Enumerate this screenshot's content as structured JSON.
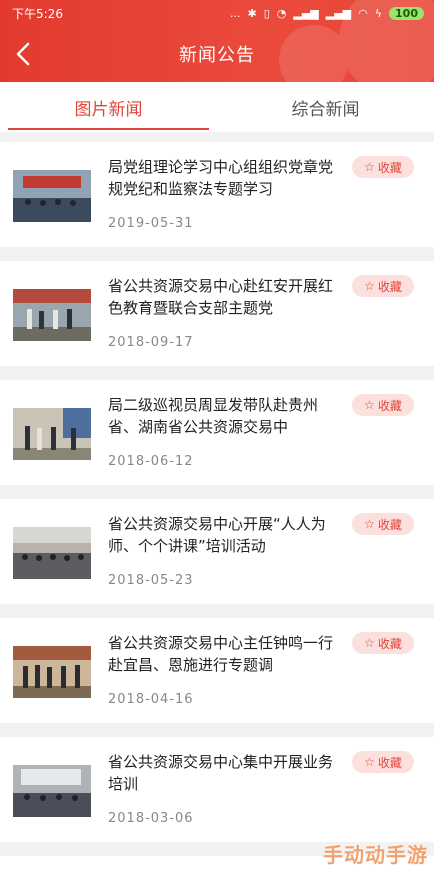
{
  "status_bar": {
    "time": "下午5:26",
    "signal_text": "...",
    "battery": "100"
  },
  "header": {
    "title": "新闻公告"
  },
  "tabs": [
    {
      "label": "图片新闻",
      "active": true
    },
    {
      "label": "综合新闻",
      "active": false
    }
  ],
  "articles": [
    {
      "title": "局党组理论学习中心组组织党章党规党纪和监察法专题学习",
      "date": "2019-05-31",
      "favorite_label": "收藏"
    },
    {
      "title": "省公共资源交易中心赴红安开展红色教育暨联合支部主题党",
      "date": "2018-09-17",
      "favorite_label": "收藏"
    },
    {
      "title": "局二级巡视员周显发带队赴贵州省、湖南省公共资源交易中",
      "date": "2018-06-12",
      "favorite_label": "收藏"
    },
    {
      "title": "省公共资源交易中心开展“人人为师、个个讲课”培训活动",
      "date": "2018-05-23",
      "favorite_label": "收藏"
    },
    {
      "title": "省公共资源交易中心主任钟鸣一行赴宜昌、恩施进行专题调",
      "date": "2018-04-16",
      "favorite_label": "收藏"
    },
    {
      "title": "省公共资源交易中心集中开展业务培训",
      "date": "2018-03-06",
      "favorite_label": "收藏"
    }
  ],
  "watermark": "手动动手游",
  "colors": {
    "accent": "#e2463a",
    "header_bg": "#e94638",
    "favorite_bg": "#fbe0de"
  }
}
